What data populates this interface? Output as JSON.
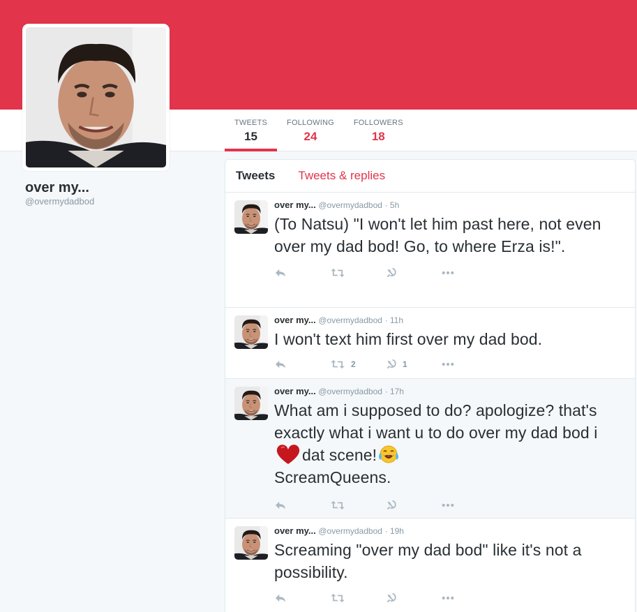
{
  "colors": {
    "accent": "#e2344a",
    "text": "#292f33",
    "muted": "#8899a6",
    "icon": "#aab8c2"
  },
  "profile": {
    "name": "over my...",
    "handle": "@overmydadbod"
  },
  "stats": [
    {
      "label": "TWEETS",
      "value": "15",
      "active": true
    },
    {
      "label": "FOLLOWING",
      "value": "24",
      "active": false
    },
    {
      "label": "FOLLOWERS",
      "value": "18",
      "active": false
    }
  ],
  "tabs": {
    "tweets": "Tweets",
    "replies": "Tweets & replies"
  },
  "tweets": [
    {
      "name": "over my...",
      "handle": "@overmydadbod",
      "time": "· 5h",
      "text": "(To Natsu) \"I won't let him past here, not even over my dad bod! Go, to where Erza is!\".",
      "retweets": "",
      "likes": ""
    },
    {
      "name": "over my...",
      "handle": "@overmydadbod",
      "time": "· 11h",
      "text": "I won't text him first over my dad bod.",
      "retweets": "2",
      "likes": "1"
    },
    {
      "name": "over my...",
      "handle": "@overmydadbod",
      "time": "· 17h",
      "text_a": "What am i supposed to do? apologize? that's exactly what i want u to do over my dad bod i",
      "text_b": "dat scene!",
      "text_c": "ScreamQueens.",
      "emoji_1": "heart-emoji",
      "emoji_2": "laughing-crying-emoji",
      "retweets": "",
      "likes": ""
    },
    {
      "name": "over my...",
      "handle": "@overmydadbod",
      "time": "· 19h",
      "text": "Screaming \"over my dad bod\" like it's not a possibility.",
      "retweets": "",
      "likes": ""
    }
  ],
  "icons": [
    "reply-icon",
    "retweet-icon",
    "hammer-sickle-icon",
    "more-icon"
  ]
}
